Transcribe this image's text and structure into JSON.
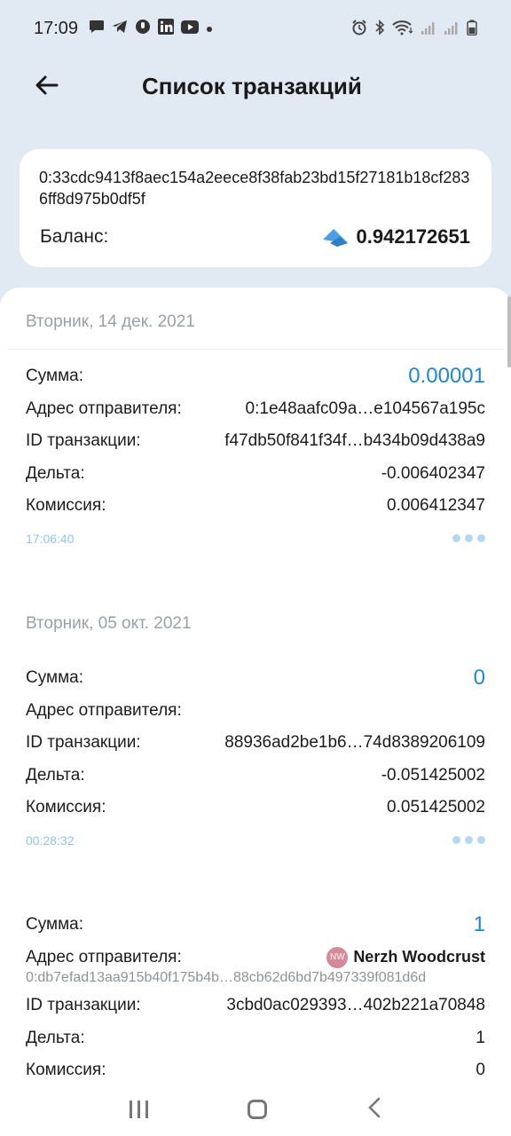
{
  "status": {
    "time": "17:09",
    "left_icons": [
      "message-icon",
      "telegram-icon",
      "mic-icon",
      "linkedin-icon",
      "youtube-icon",
      "dot-icon"
    ],
    "right_icons": [
      "alarm-icon",
      "bluetooth-icon",
      "wifi-icon",
      "signal-icon",
      "signal-r-icon",
      "battery-icon"
    ]
  },
  "header": {
    "title": "Список транзакций"
  },
  "account": {
    "address": "0:33cdc9413f8aec154a2eece8f38fab23bd15f27181b18cf2836ff8d975b0df5f",
    "balance_label": "Баланс:",
    "balance_value": "0.942172651"
  },
  "transactions": [
    {
      "date": "Вторник, 14 дек. 2021",
      "amount_label": "Сумма:",
      "amount": "0.00001",
      "sender_label": "Адрес отправителя:",
      "sender": "0:1e48aafc09a…e104567a195c",
      "txid_label": "ID транзакции:",
      "txid": "f47db50f841f34f…b434b09d438a9",
      "delta_label": "Дельта:",
      "delta": "-0.006402347",
      "fee_label": "Комиссия:",
      "fee": "0.006412347",
      "time": "17:06:40"
    },
    {
      "date": "Вторник, 05 окт. 2021",
      "amount_label": "Сумма:",
      "amount": "0",
      "sender_label": "Адрес отправителя:",
      "sender": "",
      "txid_label": "ID транзакции:",
      "txid": "88936ad2be1b6…74d8389206109",
      "delta_label": "Дельта:",
      "delta": "-0.051425002",
      "fee_label": "Комиссия:",
      "fee": "0.051425002",
      "time": "00:28:32"
    },
    {
      "amount_label": "Сумма:",
      "amount": "1",
      "sender_label": "Адрес отправителя:",
      "sender_avatar": "NW",
      "sender_name": "Nerzh Woodcrust",
      "sender_address": "0:db7efad13aa915b40f175b4b…88cb62d6bd7b497339f081d6d",
      "txid_label": "ID транзакции:",
      "txid": "3cbd0ac029393…402b221a70848",
      "delta_label": "Дельта:",
      "delta": "1",
      "fee_label": "Комиссия:",
      "fee": "0"
    }
  ],
  "colors": {
    "background": "#e1eaf3",
    "accent": "#1e88d2",
    "time_text": "#8ec5ef"
  }
}
